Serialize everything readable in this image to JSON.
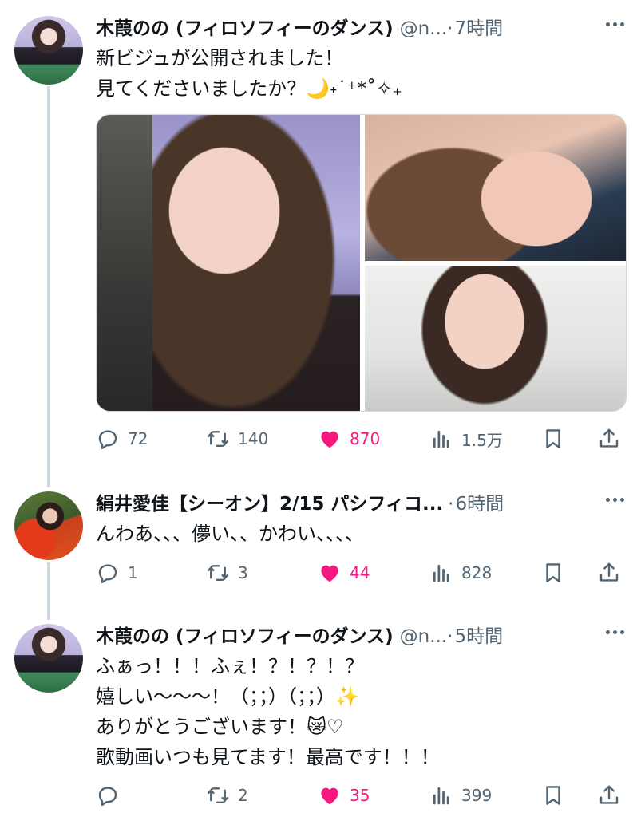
{
  "tweets": [
    {
      "author_name": "木葭のの (フィロソフィーのダンス)",
      "handle": "@n...",
      "separator": "·",
      "time": "7時間",
      "text": "新ビジュが公開されました！\n見てくださいましたか？🌙˖˙⁺*˚✧₊",
      "stats": {
        "replies": "72",
        "retweets": "140",
        "likes": "870",
        "views": "1.5万"
      }
    },
    {
      "author_name": "絹井愛佳【シーオン】2/15 パシフィコ...",
      "handle": "",
      "separator": "·",
      "time": "6時間",
      "text": "んわあ、、、儚い、、かわい、、、、",
      "stats": {
        "replies": "1",
        "retweets": "3",
        "likes": "44",
        "views": "828"
      }
    },
    {
      "author_name": "木葭のの (フィロソフィーのダンス)",
      "handle": "@n...",
      "separator": "·",
      "time": "5時間",
      "text": "ふぁっ！！！ふぇ！？！？！？\n嬉しい〜〜〜！（；；）（；；）✨\nありがとうございます！😿♡\n歌動画いつも見てます！最高です！！！",
      "stats": {
        "replies": "",
        "retweets": "2",
        "likes": "35",
        "views": "399"
      }
    }
  ],
  "icons": [
    "reply-icon",
    "retweet-icon",
    "like-icon-filled",
    "views-icon",
    "bookmark-icon",
    "share-icon",
    "more-icon"
  ],
  "colors": {
    "like": "#f91880",
    "secondary": "#536471",
    "primary_text": "#0f1419",
    "thread_line": "#cfd9de"
  }
}
